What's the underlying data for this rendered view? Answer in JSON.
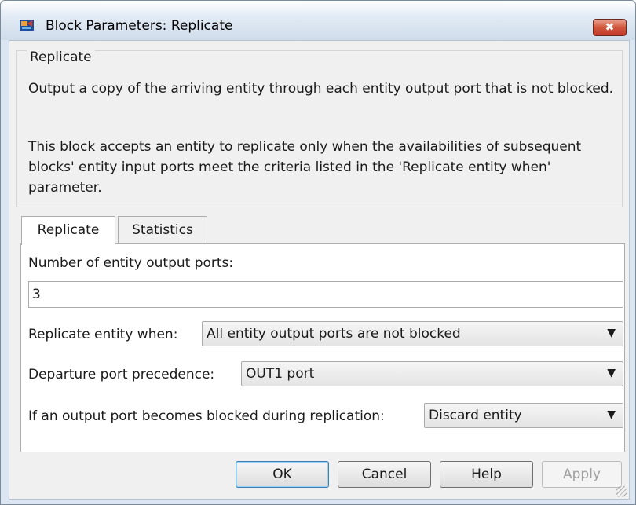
{
  "window": {
    "title": "Block Parameters: Replicate",
    "close_symbol": "✖"
  },
  "description": {
    "group_label": "Replicate",
    "paragraph1": "Output a copy of the arriving entity through each entity output port that is not blocked.",
    "paragraph2": "This block accepts an entity to replicate only when the availabilities of subsequent blocks' entity input ports meet the criteria listed in the 'Replicate entity when' parameter."
  },
  "tabs": [
    {
      "label": "Replicate",
      "active": true
    },
    {
      "label": "Statistics",
      "active": false
    }
  ],
  "params": {
    "num_ports_label": "Number of entity output ports:",
    "num_ports_value": "3",
    "replicate_when_label": "Replicate entity when:",
    "replicate_when_value": "All entity output ports are not blocked",
    "departure_label": "Departure port precedence:",
    "departure_value": "OUT1 port",
    "blocked_label": "If an output port becomes blocked during replication:",
    "blocked_value": "Discard entity"
  },
  "buttons": {
    "ok": "OK",
    "cancel": "Cancel",
    "help": "Help",
    "apply": "Apply"
  },
  "icons": {
    "window": "simulink-block-icon",
    "dropdown": "chevron-down-icon"
  }
}
